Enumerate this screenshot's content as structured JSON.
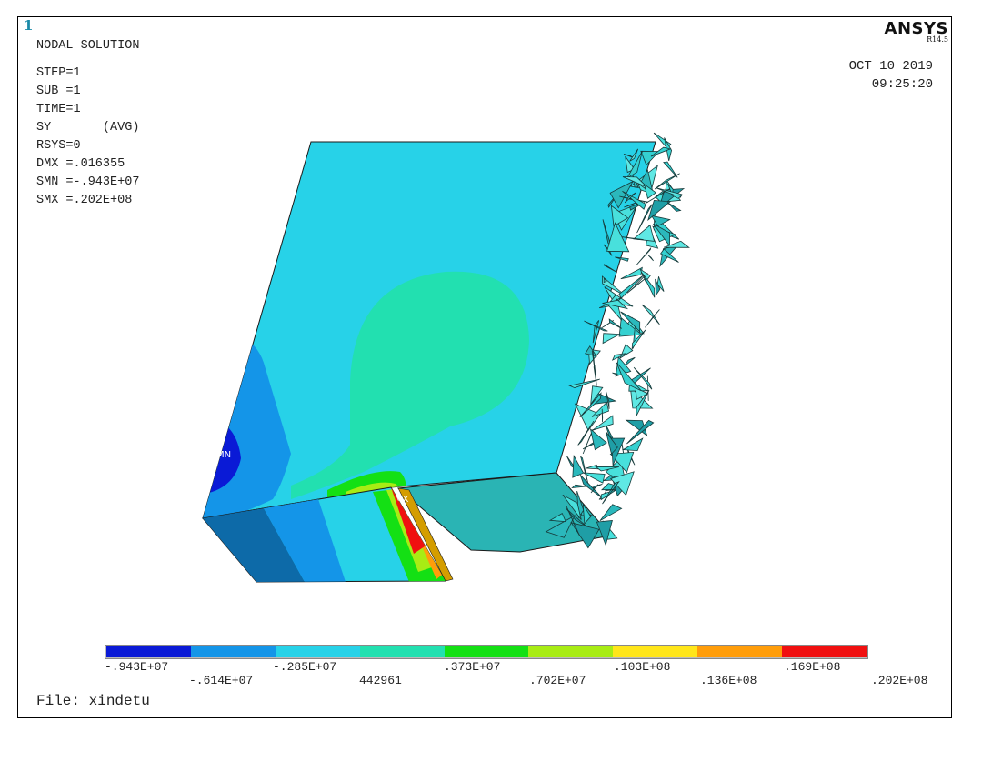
{
  "header": {
    "window_number": "1",
    "brand": "ANSYS",
    "version": "R14.5",
    "date": "OCT 10 2019",
    "time": "09:25:20"
  },
  "info": {
    "title": "NODAL SOLUTION",
    "lines": [
      "STEP=1",
      "SUB =1",
      "TIME=1",
      "SY       (AVG)",
      "RSYS=0",
      "DMX =.016355",
      "SMN =-.943E+07",
      "SMX =.202E+08"
    ]
  },
  "markers": {
    "min": "MN",
    "max": "MX"
  },
  "legend": {
    "colors": [
      "#0a1ad6",
      "#1495e8",
      "#27d2e8",
      "#22e0b0",
      "#14e014",
      "#a8ec14",
      "#ffe61a",
      "#ff9d0a",
      "#f01010"
    ],
    "labels_top": [
      "-.943E+07",
      "-.285E+07",
      ".373E+07",
      ".103E+08",
      ".169E+08"
    ],
    "labels_bottom": [
      "-.614E+07",
      "442961",
      ".702E+07",
      ".136E+08",
      ".202E+08"
    ]
  },
  "footer": {
    "file": "File: xindetu"
  }
}
